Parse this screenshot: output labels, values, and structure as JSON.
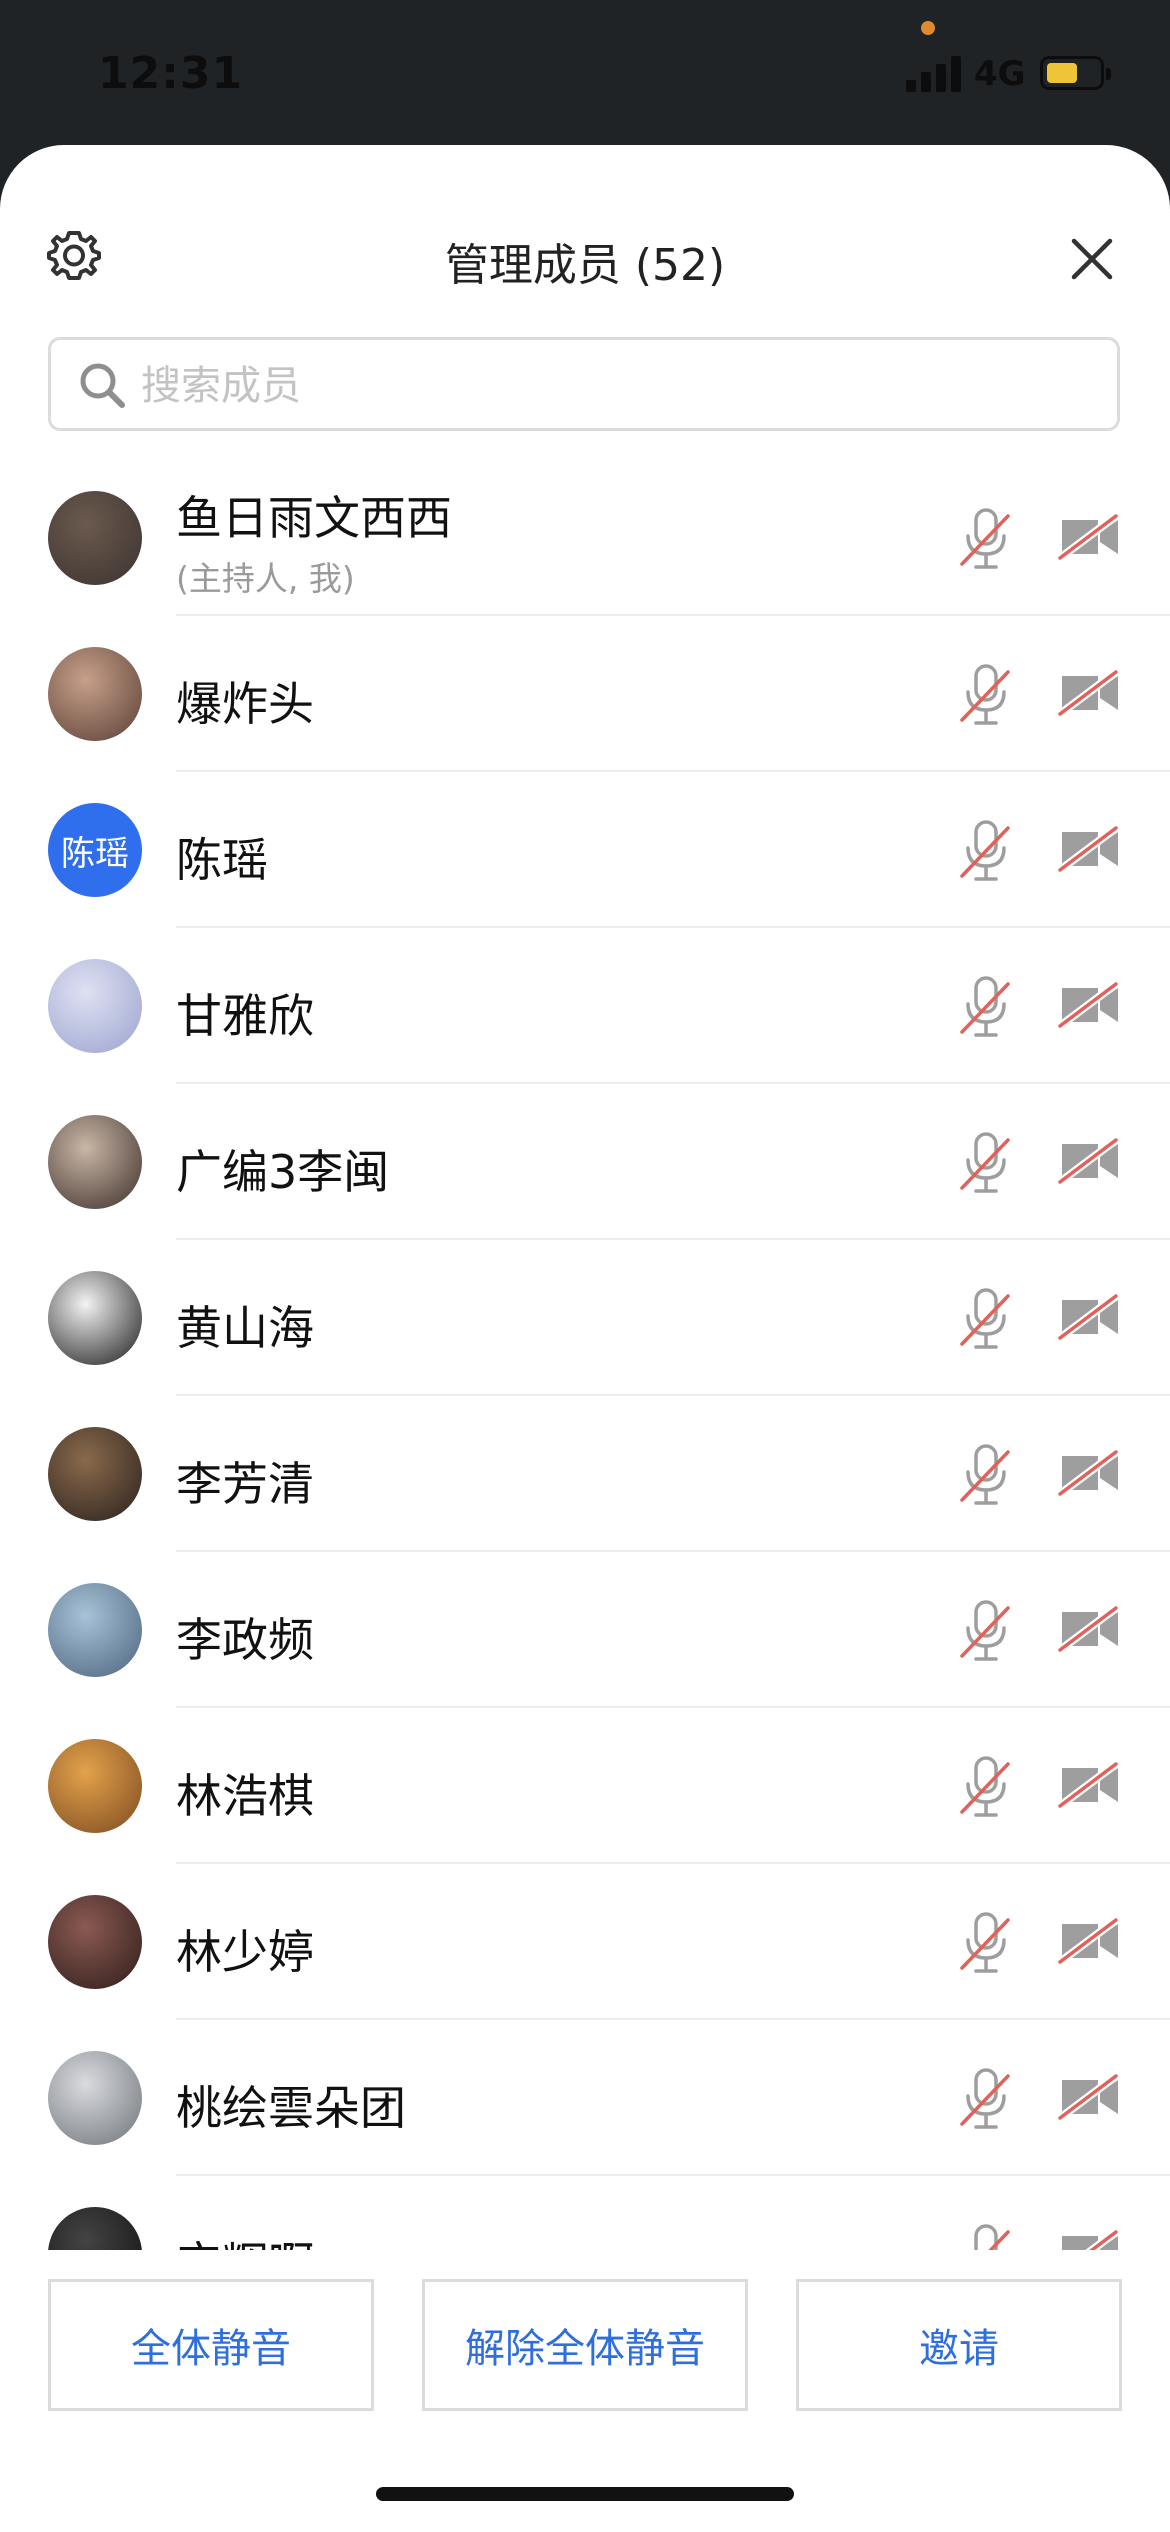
{
  "status": {
    "time": "12:31",
    "network": "4G"
  },
  "header": {
    "title": "管理成员 (52)"
  },
  "search": {
    "placeholder": "搜索成员"
  },
  "members": [
    {
      "name": "鱼日雨文西西",
      "role": "(主持人, 我)",
      "avatar_colors": [
        "#6b5a4e",
        "#3b3230"
      ]
    },
    {
      "name": "爆炸头",
      "avatar_colors": [
        "#c7a08a",
        "#5a3f35"
      ]
    },
    {
      "name": "陈瑶",
      "avatar_text": "陈瑶"
    },
    {
      "name": "甘雅欣",
      "avatar_colors": [
        "#dfe1f2",
        "#9aa3cf"
      ]
    },
    {
      "name": "广编3李闽",
      "avatar_colors": [
        "#c9b6a6",
        "#3c2f2a"
      ]
    },
    {
      "name": "黄山海",
      "avatar_colors": [
        "#f3f3f3",
        "#1a1a1a"
      ]
    },
    {
      "name": "李芳清",
      "avatar_colors": [
        "#8a6a4c",
        "#2a211d"
      ]
    },
    {
      "name": "李政频",
      "avatar_colors": [
        "#a8c2d8",
        "#4b647c"
      ]
    },
    {
      "name": "林浩棋",
      "avatar_colors": [
        "#e3a24b",
        "#7b4a20"
      ]
    },
    {
      "name": "林少婷",
      "avatar_colors": [
        "#8a5a52",
        "#2e1c1a"
      ]
    },
    {
      "name": "桃绘雲朵团",
      "avatar_colors": [
        "#d9dbdf",
        "#6f7379"
      ]
    },
    {
      "name": "宝辉啊",
      "avatar_colors": [
        "#444444",
        "#111111"
      ]
    }
  ],
  "footer": {
    "mute_all": "全体静音",
    "unmute_all": "解除全体静音",
    "invite": "邀请"
  },
  "colors": {
    "accent": "#2f6fdc",
    "mute_slash": "#e0625a",
    "icon_gray": "#9e9e9e"
  }
}
